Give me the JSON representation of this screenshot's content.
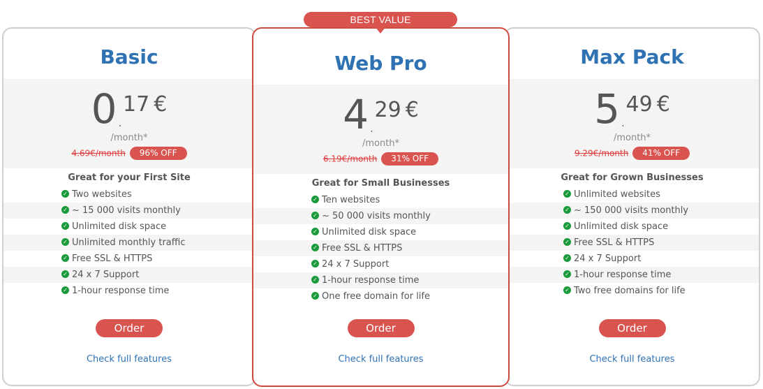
{
  "colors": {
    "title": "#2f72b3",
    "accent": "#d9534f",
    "check": "#1a9a3a",
    "old_price": "#e13b3b"
  },
  "badge": {
    "label": "BEST VALUE"
  },
  "plans": [
    {
      "name": "Basic",
      "price_int": "0",
      "price_dec": "17",
      "currency": "€",
      "per_month": "/month*",
      "old_price": "4.69€/month",
      "discount": "96% OFF",
      "tagline": "Great for your First Site",
      "features": [
        "Two websites",
        "~ 15 000 visits monthly",
        "Unlimited disk space",
        "Unlimited monthly traffic",
        "Free SSL & HTTPS",
        "24 x 7 Support",
        "1-hour response time"
      ],
      "order_label": "Order",
      "link_label": "Check full features"
    },
    {
      "name": "Web Pro",
      "price_int": "4",
      "price_dec": "29",
      "currency": "€",
      "per_month": "/month*",
      "old_price": "6.19€/month",
      "discount": "31% OFF",
      "tagline": "Great for Small Businesses",
      "features": [
        "Ten websites",
        "~ 50 000 visits monthly",
        "Unlimited disk space",
        "Free SSL & HTTPS",
        "24 x 7 Support",
        "1-hour response time",
        "One free domain for life"
      ],
      "order_label": "Order",
      "link_label": "Check full features"
    },
    {
      "name": "Max Pack",
      "price_int": "5",
      "price_dec": "49",
      "currency": "€",
      "per_month": "/month*",
      "old_price": "9.29€/month",
      "discount": "41% OFF",
      "tagline": "Great for Grown Businesses",
      "features": [
        "Unlimited websites",
        "~ 150 000 visits monthly",
        "Unlimited disk space",
        "Free SSL & HTTPS",
        "24 x 7 Support",
        "1-hour response time",
        "Two free domains for life"
      ],
      "order_label": "Order",
      "link_label": "Check full features"
    }
  ]
}
